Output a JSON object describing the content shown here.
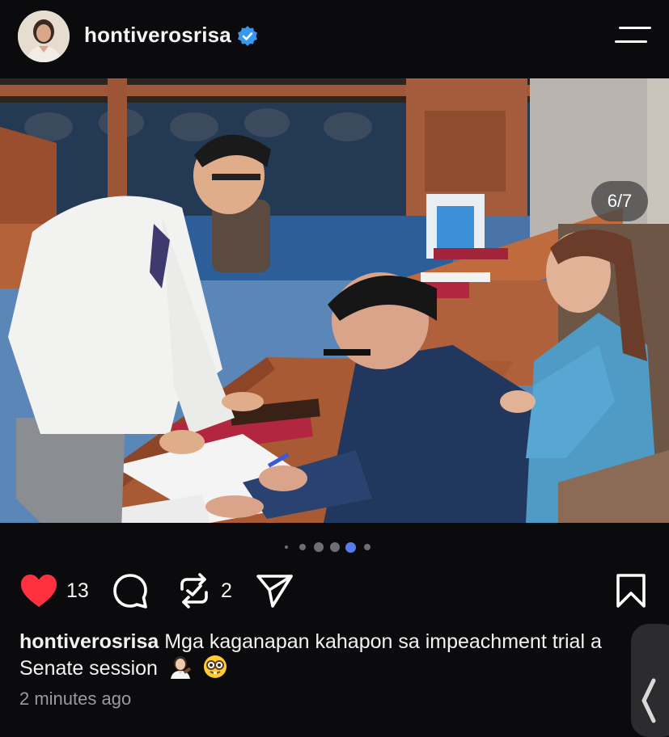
{
  "header": {
    "username": "hontiverosrisa",
    "avatar_icon": "profile-avatar",
    "verified_icon": "verified-badge-icon",
    "menu_icon": "hamburger-menu-icon"
  },
  "photo": {
    "counter": "6/7"
  },
  "carousel": {
    "total_dots": 6,
    "active_index": 4
  },
  "actions": {
    "like_count": "13",
    "repost_count": "2",
    "icons": [
      "heart-icon",
      "comment-icon",
      "repost-icon",
      "share-icon",
      "bookmark-icon"
    ],
    "like_color": "#ff3040"
  },
  "caption": {
    "username": "hontiverosrisa",
    "text_line1": "Mga kaganapan kahapon sa impeachment trial a",
    "text_line2": "Senate session",
    "emojis": [
      "woman-judge-emoji",
      "nerd-face-emoji"
    ]
  },
  "timestamp": "2 minutes ago"
}
